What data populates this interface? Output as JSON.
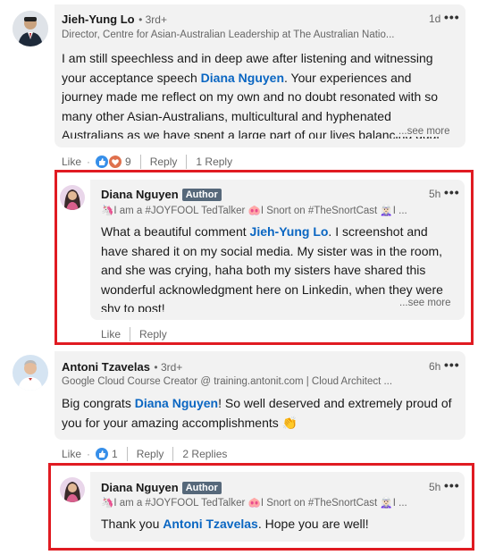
{
  "comments": [
    {
      "name": "Jieh-Yung Lo",
      "degree": "• 3rd+",
      "headline": "Director, Centre for Asian-Australian Leadership at The Australian Natio...",
      "time": "1d",
      "text_before": "I am still speechless and in deep awe after listening and witnessing your acceptance speech ",
      "mention": "Diana Nguyen",
      "text_after": ". Your experiences and journey made me reflect on my own and no doubt resonated with so many other Asian-Australians, multicultural and hyphenated Australians as we have spent a large part of our lives balancing dual and m",
      "see_more": "...see more",
      "like_label": "Like",
      "reaction_count": "9",
      "reply_label": "Reply",
      "replies_label": "1 Reply"
    },
    {
      "name": "Diana Nguyen",
      "badge": "Author",
      "headline": "🦄I am a #JOYFOOL TedTalker 🐽I Snort on #TheSnortCast 🧝🏻‍♀️I ...",
      "time": "5h",
      "text_before": "What a beautiful comment ",
      "mention": "Jieh-Yung Lo",
      "text_after": ". I screenshot and have shared it on my social media. My sister was in the room, and she was crying, haha both my sisters have shared this wonderful acknowledgment here on Linkedin, when they were shy to post!",
      "see_more": "...see more",
      "like_label": "Like",
      "reply_label": "Reply"
    },
    {
      "name": "Antoni Tzavelas",
      "degree": "• 3rd+",
      "headline": "Google Cloud Course Creator @ training.antonit.com | Cloud Architect ...",
      "time": "6h",
      "text_before": "Big congrats ",
      "mention": "Diana Nguyen",
      "text_after": "! So well deserved and extremely proud of you for your amazing accomplishments 👏",
      "like_label": "Like",
      "reaction_count": "1",
      "reply_label": "Reply",
      "replies_label": "2 Replies"
    },
    {
      "name": "Diana Nguyen",
      "badge": "Author",
      "headline": "🦄I am a #JOYFOOL TedTalker 🐽I Snort on #TheSnortCast 🧝🏻‍♀️I ...",
      "time": "5h",
      "text_before": "Thank you ",
      "mention": "Antoni Tzavelas",
      "text_after": ". Hope you are well!"
    }
  ],
  "colors": {
    "highlight": "#e01b22",
    "link": "#0a66c2",
    "bubble": "#f2f2f2"
  },
  "icons": [
    "like-reaction-icon",
    "love-reaction-icon",
    "more-options-icon"
  ]
}
